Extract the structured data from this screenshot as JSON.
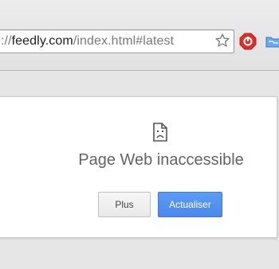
{
  "browser": {
    "url_prefix": "://",
    "url_host": "feedly.com",
    "url_path": "/index.html#latest",
    "icons": [
      "bookmark-star-icon",
      "stop-extension-icon",
      "folder-extension-icon"
    ]
  },
  "error_page": {
    "icon": "sad-page-icon",
    "title": "Page Web inaccessible",
    "buttons": {
      "more": "Plus",
      "reload": "Actualiser"
    }
  },
  "colors": {
    "accent_button": "#4a87ee",
    "stop_icon": "#d9302a"
  }
}
